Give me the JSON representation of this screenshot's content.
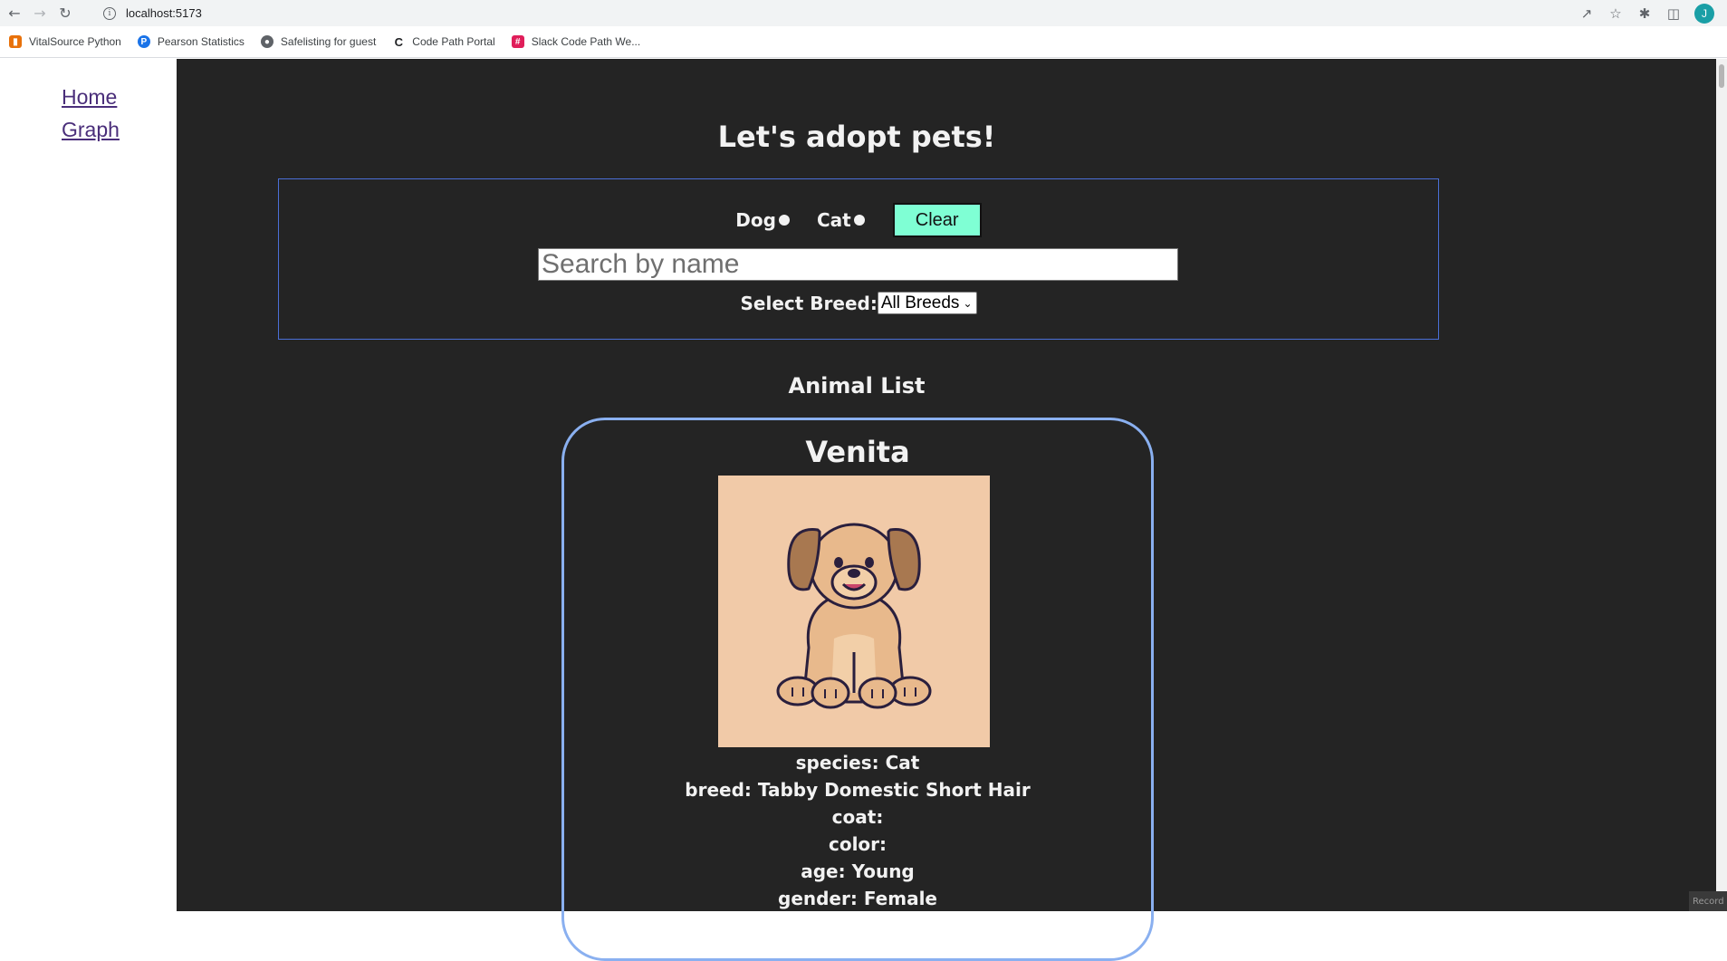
{
  "browser": {
    "url": "localhost:5173",
    "avatar_letter": "J",
    "bookmarks": [
      {
        "label": "VitalSource Python",
        "color": "#e8710a"
      },
      {
        "label": "Pearson Statistics",
        "color": "#1a73e8"
      },
      {
        "label": "Safelisting for guest",
        "color": "#5f6368"
      },
      {
        "label": "Code Path Portal",
        "color": "#202124"
      },
      {
        "label": "Slack Code Path We...",
        "color": "#e01e5a"
      }
    ]
  },
  "sidebar": {
    "links": [
      "Home",
      "Graph"
    ]
  },
  "main": {
    "title": "Let's adopt pets!",
    "filters": {
      "dog_label": "Dog",
      "cat_label": "Cat",
      "clear_label": "Clear",
      "search_placeholder": "Search by name",
      "breed_label": "Select Breed:",
      "breed_selected": "All Breeds"
    },
    "list_title": "Animal List",
    "card": {
      "name": "Venita",
      "details": [
        "species: Cat",
        "breed: Tabby Domestic Short Hair",
        "coat:",
        "color:",
        "age: Young",
        "gender: Female"
      ]
    }
  },
  "colors": {
    "main_bg": "#242424",
    "accent_button": "#7fffd4",
    "card_border": "#8ab0f0",
    "filter_border": "#4a6fd6",
    "link": "#4a2e7a"
  },
  "record_badge": "Record"
}
